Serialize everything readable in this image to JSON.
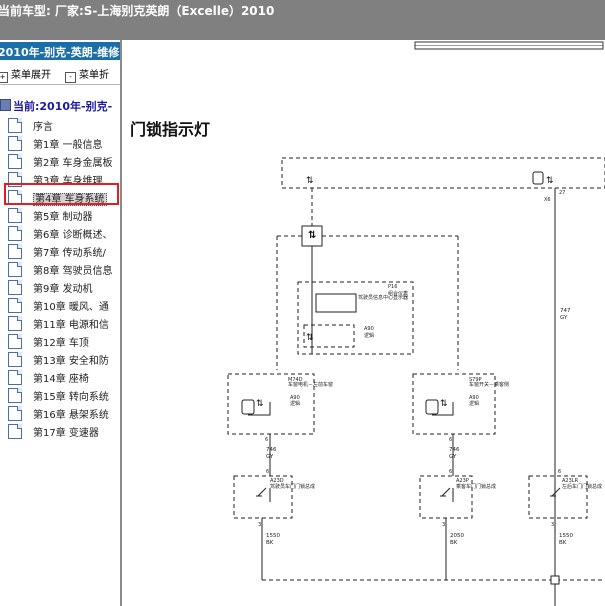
{
  "header": {
    "title": "当前车型:  厂家:S-上海别克英朗（Excelle）2010"
  },
  "sidebar": {
    "heading": "2010年-别克-英朗-维修",
    "expand_label": "菜单展开",
    "collapse_label": "菜单折",
    "root_label": "当前:2010年-别克-",
    "items": [
      {
        "label": "序言"
      },
      {
        "label": "第1章 一般信息"
      },
      {
        "label": "第2章 车身金属板"
      },
      {
        "label": "第3章 车身维理"
      },
      {
        "label": "第4章 车身系统"
      },
      {
        "label": "第5章 制动器"
      },
      {
        "label": "第6章 诊断概述、"
      },
      {
        "label": "第7章 传动系统/"
      },
      {
        "label": "第8章 驾驶员信息"
      },
      {
        "label": "第9章 发动机"
      },
      {
        "label": "第10章 暖风、通"
      },
      {
        "label": "第11章 电源和信"
      },
      {
        "label": "第12章 车顶"
      },
      {
        "label": "第13章 安全和防"
      },
      {
        "label": "第14章 座椅"
      },
      {
        "label": "第15章 转向系统"
      },
      {
        "label": "第16章 悬架系统"
      },
      {
        "label": "第17章 变速器"
      }
    ],
    "selected_index": 4
  },
  "content": {
    "page_title": "门锁指示灯",
    "diagram": {
      "connector_top": "X6",
      "pin_27": "27",
      "wire_747": "747",
      "wire_747_color": "GY",
      "p16_code": "P16",
      "p16_name": "组合仪表",
      "p16_inner": "驾驶员信息中心显示器",
      "a90_inner": "A90",
      "a90_inner_name": "逻辑",
      "m74d_code": "M74D",
      "m74d_name": "车窗电机－左前车窗",
      "a90_left": "A90",
      "a90_left_name": "逻辑",
      "s79p_code": "S79P",
      "s79p_name": "车窗开关－乘客侧",
      "a90_right": "A90",
      "a90_right_name": "逻辑",
      "pin_6a": "6",
      "wire_746a": "746",
      "wire_746a_color": "GY",
      "pin_6b": "6",
      "wire_746b": "746",
      "wire_746b_color": "GY",
      "a23d_code": "A23D",
      "a23d_name": "驾驶员车门门锁总成",
      "a23p_code": "A23P",
      "a23p_name": "乘客车门门锁总成",
      "a23lr_code": "A23LR",
      "a23lr_name": "左后车门门锁总成",
      "pin_6c": "6",
      "pin_6d": "6",
      "pin_6e": "6",
      "pin_3a": "3",
      "pin_3b": "3",
      "pin_3c": "3",
      "wire_1550a": "1550",
      "wire_1550a_color": "BK",
      "wire_2050": "2050",
      "wire_2050_color": "BK",
      "wire_1550b": "1550",
      "wire_1550b_color": "BK"
    }
  },
  "colors": {
    "topbar": "#808080",
    "sidebar_heading": "#1b6fa8",
    "highlight": "#e02020"
  }
}
